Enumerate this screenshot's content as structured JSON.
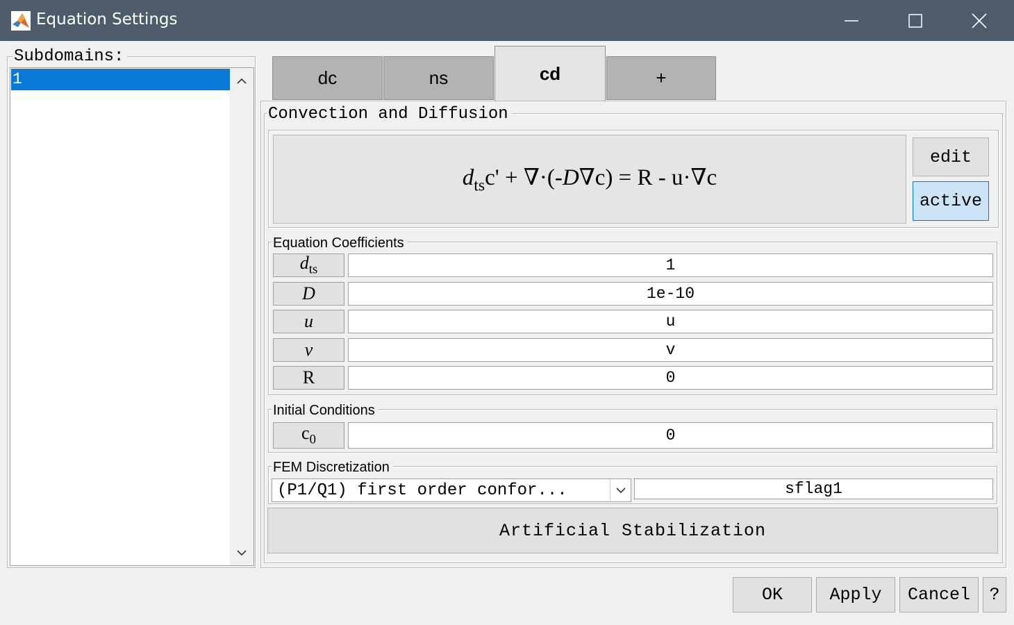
{
  "window": {
    "title": "Equation Settings",
    "app_icon": "matlab-icon",
    "controls": [
      "minimize-icon",
      "maximize-icon",
      "close-icon"
    ]
  },
  "subdomains": {
    "label": "Subdomains:",
    "items": [
      "1"
    ],
    "selected": "1"
  },
  "tabs": [
    {
      "label": "dc",
      "active": false
    },
    {
      "label": "ns",
      "active": false
    },
    {
      "label": "cd",
      "active": true
    },
    {
      "label": "+",
      "active": false
    }
  ],
  "physics": {
    "group_label": "Convection and Diffusion",
    "equation": {
      "coef": "d",
      "coef_sub": "ts",
      "var": "c",
      "lhs_rest": "' + ∇·(-",
      "diff": "D",
      "grad_var": "∇c",
      "rhs": ") = R - u·∇c"
    },
    "edit_label": "edit",
    "active_label": "active"
  },
  "coefficients": {
    "group_label": "Equation Coefficients",
    "rows": [
      {
        "symbol": "d",
        "sub": "ts",
        "value": "1"
      },
      {
        "symbol": "D",
        "sub": "",
        "value": "1e-10"
      },
      {
        "symbol": "u",
        "sub": "",
        "value": "u"
      },
      {
        "symbol": "v",
        "sub": "",
        "value": "v"
      },
      {
        "symbol": "R",
        "sub": "",
        "value": "0"
      }
    ]
  },
  "initial_conditions": {
    "group_label": "Initial Conditions",
    "symbol": "c",
    "sub": "0",
    "value": "0"
  },
  "fem": {
    "group_label": "FEM Discretization",
    "selected_option": "(P1/Q1) first order confor...",
    "shape_flag": "sflag1"
  },
  "stabilization_label": "Artificial Stabilization",
  "dialog_buttons": {
    "ok": "OK",
    "apply": "Apply",
    "cancel": "Cancel",
    "help": "?"
  },
  "colors": {
    "titlebar": "#4e5b6a",
    "selection": "#0a78d7",
    "active_toggle": "#cce4f7",
    "tab_inactive": "#b3b3b3"
  }
}
